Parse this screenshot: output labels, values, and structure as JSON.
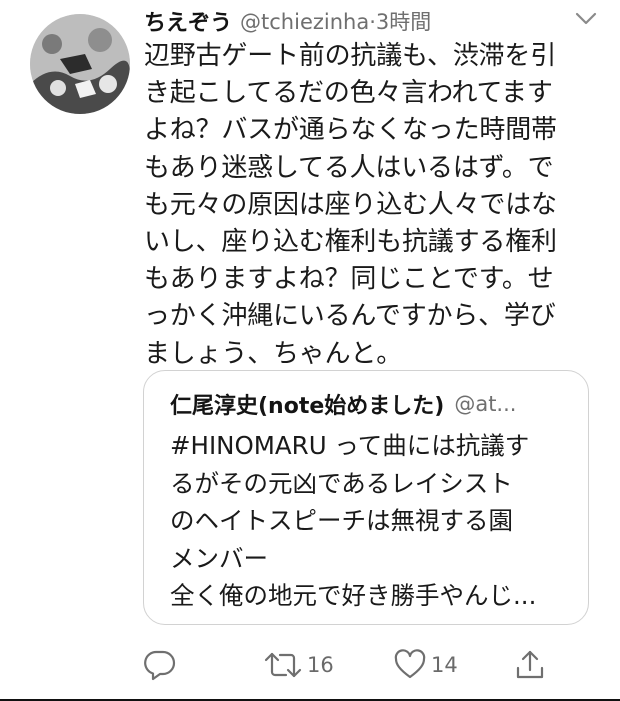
{
  "tweet": {
    "display_name": "ちえぞう",
    "handle": "@tchiezinha",
    "separator": "·",
    "time": "3時間",
    "text_lines": [
      "辺野古ゲート前の抗議も、渋滞を引",
      "き起こしてるだの色々言われてます",
      "よね？バスが通らなくなった時間帯",
      "もあり迷惑してる人はいるはず。で",
      "も元々の原因は座り込む人々ではな",
      "いし、座り込む権利も抗議する権利",
      "もありますよね？同じことです。せ",
      "っかく沖縄にいるんですから、学び",
      "ましょう、ちゃんと。"
    ]
  },
  "quote": {
    "display_name": "仁尾淳史(note始めました)",
    "handle": "@at...",
    "text_lines": [
      "#HINOMARU って曲には抗議す",
      "るがその元凶であるレイシスト",
      "のヘイトスピーチは無視する園",
      "メンバー",
      "全く俺の地元で好き勝手やんじ..."
    ]
  },
  "actions": {
    "reply_icon": "reply-icon",
    "retweet_icon": "retweet-icon",
    "retweet_count": "16",
    "like_icon": "heart-icon",
    "like_count": "14",
    "share_icon": "share-icon"
  },
  "colors": {
    "text": "#1a1a1a",
    "secondary_text": "#6f6f6f",
    "border": "#d2d2d2",
    "background": "#ffffff"
  }
}
